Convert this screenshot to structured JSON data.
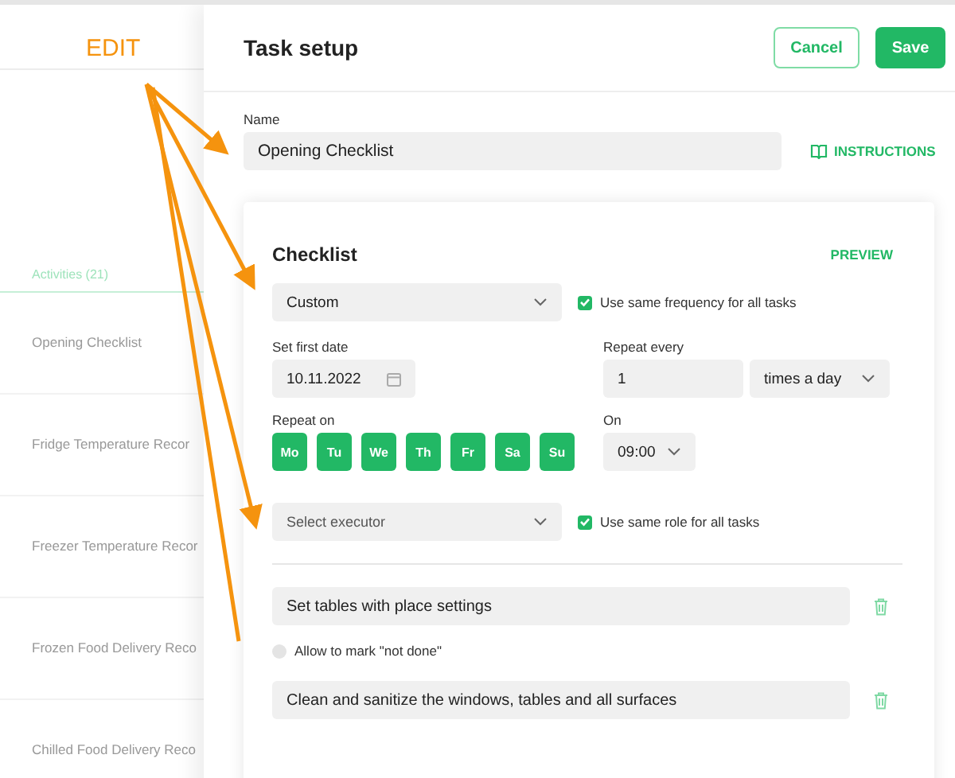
{
  "annotation": {
    "label": "EDIT"
  },
  "activities": {
    "heading": "Activities (21)",
    "items": [
      {
        "label": "Opening Checklist"
      },
      {
        "label": "Fridge Temperature Recor"
      },
      {
        "label": "Freezer Temperature Recor"
      },
      {
        "label": "Frozen Food Delivery Reco"
      },
      {
        "label": "Chilled Food Delivery Reco"
      }
    ]
  },
  "task_setup": {
    "title": "Task setup",
    "cancel": "Cancel",
    "save": "Save",
    "name_label": "Name",
    "name_value": "Opening Checklist",
    "instructions": "INSTRUCTIONS",
    "checklist": {
      "title": "Checklist",
      "preview": "PREVIEW",
      "frequency": "Custom",
      "same_frequency": {
        "label": "Use same frequency for all tasks",
        "checked": true
      },
      "first_date_label": "Set first date",
      "first_date": "10.11.2022",
      "repeat_every_label": "Repeat every",
      "repeat_every": "1",
      "repeat_unit": "times a day",
      "repeat_on_label": "Repeat on",
      "days": [
        {
          "label": "Mo",
          "selected": true
        },
        {
          "label": "Tu",
          "selected": true
        },
        {
          "label": "We",
          "selected": true
        },
        {
          "label": "Th",
          "selected": true
        },
        {
          "label": "Fr",
          "selected": true
        },
        {
          "label": "Sa",
          "selected": true
        },
        {
          "label": "Su",
          "selected": true
        }
      ],
      "on_label": "On",
      "time": "09:00",
      "executor_placeholder": "Select executor",
      "same_role": {
        "label": "Use same role for all tasks",
        "checked": true
      },
      "tasks": [
        {
          "name": "Set tables with place settings",
          "allow_not_done": {
            "label": "Allow to mark \"not done\"",
            "checked": false
          }
        },
        {
          "name": "Clean and sanitize the windows, tables and all surfaces"
        }
      ]
    }
  }
}
